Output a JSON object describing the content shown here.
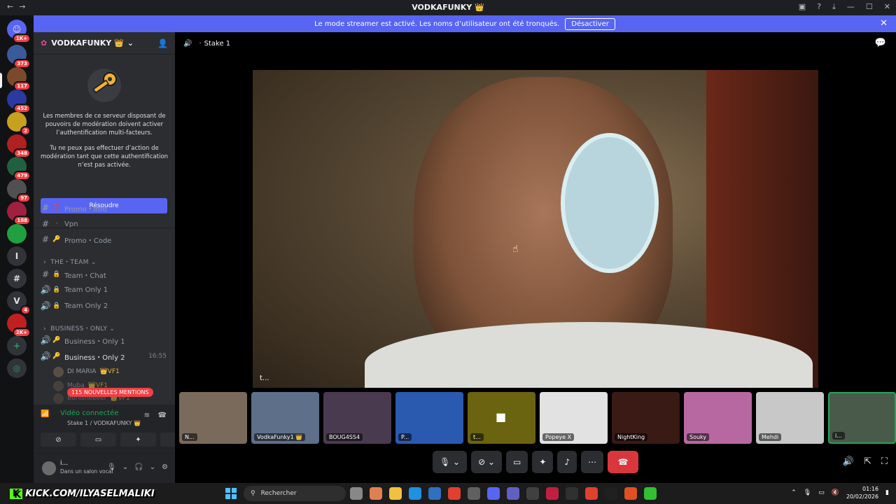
{
  "titlebar": {
    "title": "VODKAFUNKY 👑"
  },
  "banner": {
    "message": "Le mode streamer est activé. Les noms d’utilisateur ont été tronqués.",
    "button": "Désactiver"
  },
  "rail": {
    "badges": [
      "1K+",
      "373",
      "117",
      "452",
      "2",
      "348",
      "479",
      "97",
      "188",
      "4",
      "2K+"
    ]
  },
  "server": {
    "name": "VODKAFUNKY 👑"
  },
  "mfa": {
    "text1": "Les membres de ce serveur disposant de pouvoirs de modération doivent activer l’authentification multi-facteurs.",
    "text2": "Tu ne peux pas effectuer d’action de modération tant que cette authentification n’est pas activée.",
    "button": "Résoudre"
  },
  "channels": {
    "promo_info": "Promo・Info",
    "vpn": "Vpn",
    "promo_code": "Promo・Code",
    "cat_team": "THE・TEAM",
    "team_chat": "Team・Chat",
    "team_only1": "Team Only 1",
    "team_only2": "Team Only 2",
    "cat_business": "BUSINESS・ONLY",
    "business_only1": "Business・Only 1",
    "business_only2": "Business・Only 2",
    "business_time": "16:55"
  },
  "members": [
    "DI MARIA",
    "Muba",
    "Bunisheeeer"
  ],
  "member_tag": "VF1",
  "mentions": "115 NOUVELLES MENTIONS",
  "voice": {
    "status": "Vidéo connectée",
    "sub": "Stake 1 / VODKAFUNKY 👑"
  },
  "user": {
    "name": "i...",
    "status": "Dans un salon vocal"
  },
  "main": {
    "channel": "Stake 1",
    "stage_label": "t..."
  },
  "tiles": [
    {
      "label": "N...",
      "color": "#7a6a5c"
    },
    {
      "label": "VodkaFunky1 👑",
      "color": "#5e6f8a"
    },
    {
      "label": "BOUG4SS4",
      "color": "#4a3a50"
    },
    {
      "label": "P...",
      "color": "#2a5ab0"
    },
    {
      "label": "t...",
      "color": "#6a6410"
    },
    {
      "label": "Popeye X",
      "color": "#e2e2e2"
    },
    {
      "label": "NightKing",
      "color": "#3a1a14"
    },
    {
      "label": "Souky",
      "color": "#b868a0"
    },
    {
      "label": "Mehdi",
      "color": "#c8c8c8"
    },
    {
      "label": "i...",
      "color": "#4a5a4a"
    }
  ],
  "taskbar": {
    "kick": "KICK.COM/ILYASELMALIKI",
    "search": "Rechercher",
    "time": "01:16",
    "date": "20/02/2026"
  }
}
